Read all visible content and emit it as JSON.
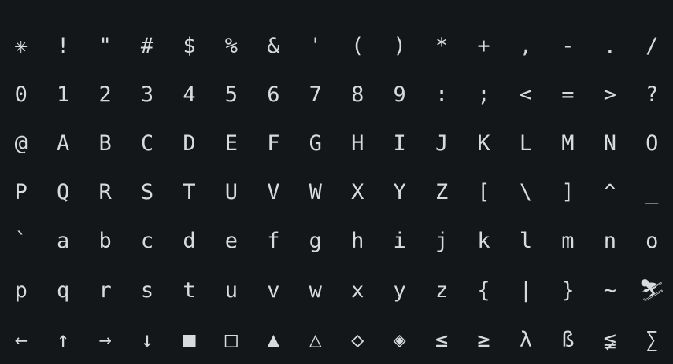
{
  "rows": [
    [
      "✳",
      "!",
      "\"",
      "#",
      "$",
      "%",
      "&",
      "'",
      "(",
      ")",
      "*",
      "+",
      ",",
      "-",
      ".",
      "/"
    ],
    [
      "0",
      "1",
      "2",
      "3",
      "4",
      "5",
      "6",
      "7",
      "8",
      "9",
      ":",
      ";",
      "<",
      "=",
      ">",
      "?"
    ],
    [
      "@",
      "A",
      "B",
      "C",
      "D",
      "E",
      "F",
      "G",
      "H",
      "I",
      "J",
      "K",
      "L",
      "M",
      "N",
      "O"
    ],
    [
      "P",
      "Q",
      "R",
      "S",
      "T",
      "U",
      "V",
      "W",
      "X",
      "Y",
      "Z",
      "[",
      "\\",
      "]",
      "^",
      "_"
    ],
    [
      "`",
      "a",
      "b",
      "c",
      "d",
      "e",
      "f",
      "g",
      "h",
      "i",
      "j",
      "k",
      "l",
      "m",
      "n",
      "o"
    ],
    [
      "p",
      "q",
      "r",
      "s",
      "t",
      "u",
      "v",
      "w",
      "x",
      "y",
      "z",
      "{",
      "|",
      "}",
      "~",
      "⛷"
    ],
    [
      "←",
      "↑",
      "→",
      "↓",
      "■",
      "□",
      "▲",
      "△",
      "◇",
      "◈",
      "≤",
      "≥",
      "λ",
      "ß",
      "≨",
      "∑"
    ]
  ],
  "colors": {
    "background": "#131719",
    "glyph": "#d8dbdc"
  }
}
